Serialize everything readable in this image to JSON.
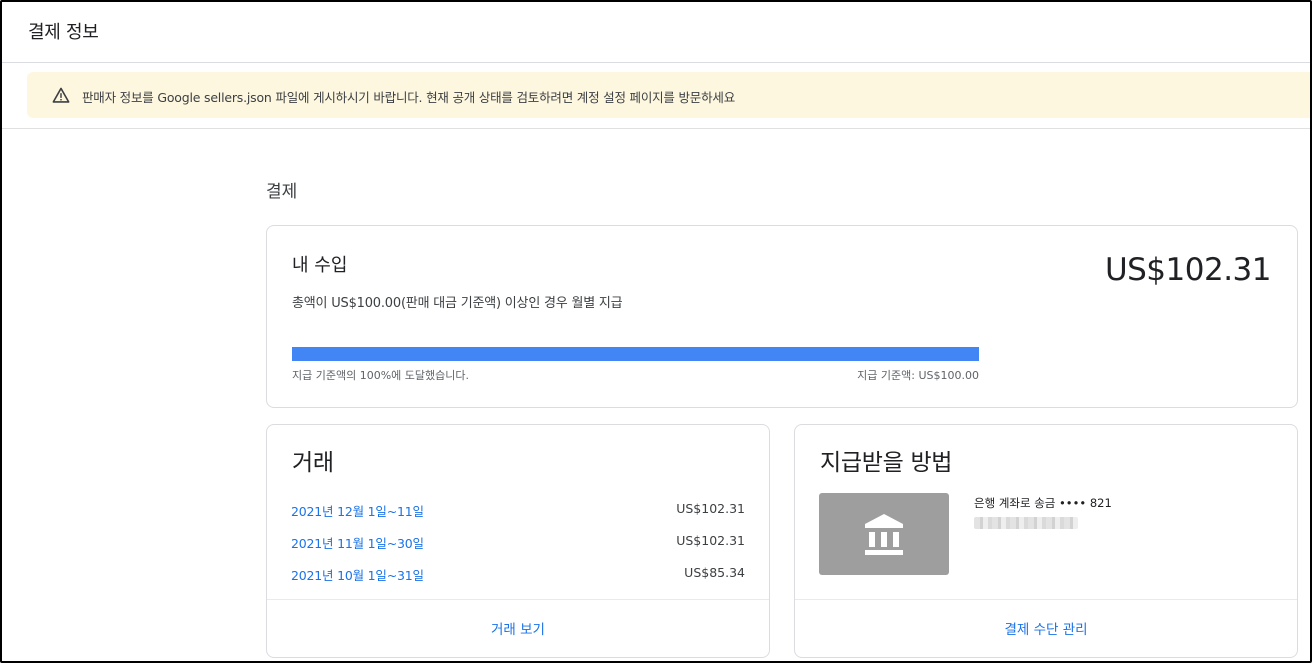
{
  "page": {
    "title": "결제 정보"
  },
  "banner": {
    "icon": "warning-icon",
    "text": "판매자 정보를 Google sellers.json 파일에 게시하시기 바랍니다. 현재 공개 상태를 검토하려면 계정 설정 페이지를 방문하세요",
    "background": "#fef7e0"
  },
  "payments": {
    "section_title": "결제",
    "earnings": {
      "title": "내 수입",
      "amount": "US$102.31",
      "description": "총액이 US$100.00(판매 대금 기준액) 이상인 경우 월별 지급",
      "progress_fraction": 1.0,
      "progress_label": "지급 기준액의 100%에 도달했습니다.",
      "threshold_label": "지급 기준액: US$100.00",
      "progress_color": "#4285f4"
    },
    "transactions": {
      "title": "거래",
      "rows": [
        {
          "period": "2021년 12월 1일~11일",
          "amount": "US$102.31"
        },
        {
          "period": "2021년 11월 1일~30일",
          "amount": "US$102.31"
        },
        {
          "period": "2021년 10월 1일~31일",
          "amount": "US$85.34"
        }
      ],
      "view_link": "거래 보기"
    },
    "payment_method": {
      "title": "지급받을 방법",
      "icon": "bank-icon",
      "method": "은행 계좌로 송금 •••• 821",
      "manage_link": "결제 수단 관리"
    }
  },
  "colors": {
    "link": "#1a73e8",
    "border": "#dadce0",
    "bank_tile": "#9e9e9e"
  }
}
